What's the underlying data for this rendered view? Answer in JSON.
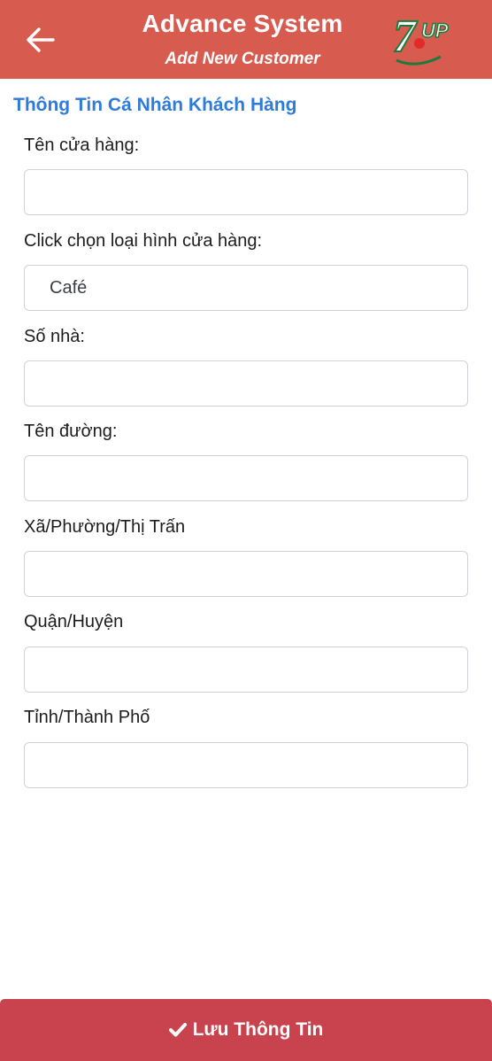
{
  "header": {
    "title": "Advance System",
    "subtitle": "Add New Customer",
    "brand_logo_text": "7UP",
    "background_color": "#d85b4f"
  },
  "section_title": "Thông Tin Cá Nhân Khách Hàng",
  "fields": [
    {
      "label": "Tên cửa hàng:",
      "value": ""
    },
    {
      "label": "Click chọn loại hình cửa hàng:",
      "value": "Café"
    },
    {
      "label": "Số nhà:",
      "value": ""
    },
    {
      "label": "Tên đường:",
      "value": ""
    },
    {
      "label": "Xã/Phường/Thị Trấn",
      "value": ""
    },
    {
      "label": "Quận/Huyện",
      "value": ""
    },
    {
      "label": "Tỉnh/Thành Phố",
      "value": ""
    }
  ],
  "save_button": {
    "label": "Lưu Thông Tin",
    "icon": "check-icon",
    "color": "#c9434e"
  },
  "accent_color": "#2f7bd9"
}
